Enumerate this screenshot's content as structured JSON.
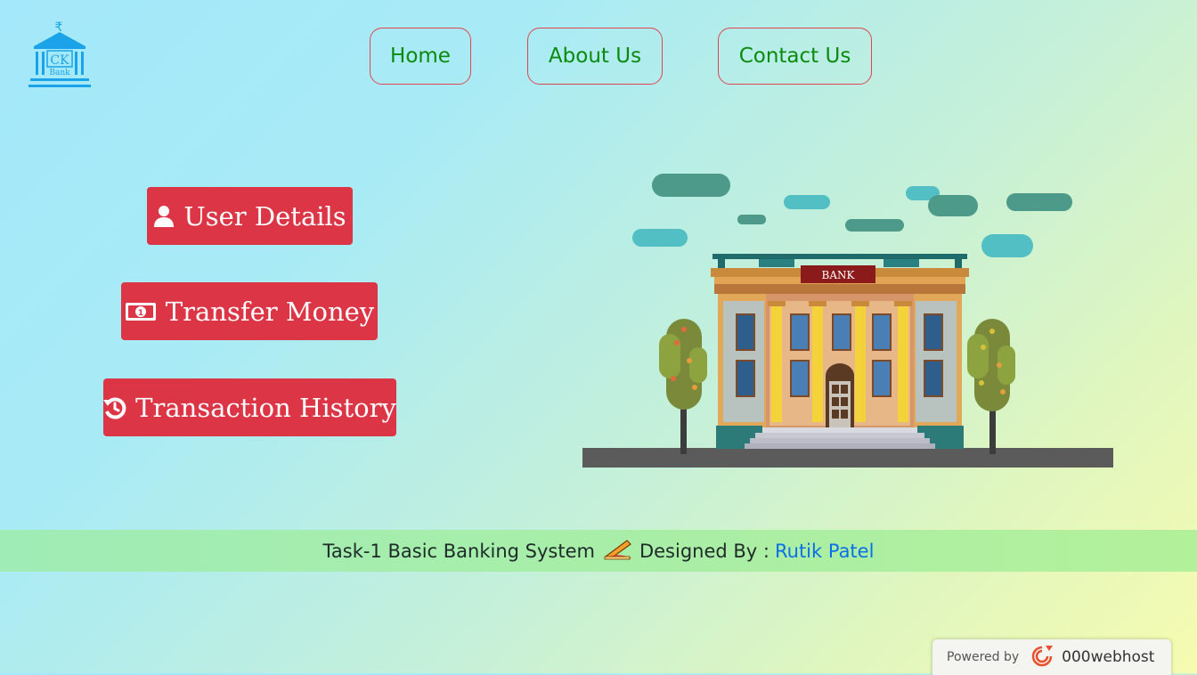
{
  "logo": {
    "text_top": "CK",
    "text_bottom": "Bank",
    "symbol": "₹",
    "color": "#1aa3e8"
  },
  "nav": {
    "items": [
      {
        "label": "Home"
      },
      {
        "label": "About Us"
      },
      {
        "label": "Contact Us"
      }
    ],
    "text_color": "#0c8a0c",
    "border_color": "#e1464f"
  },
  "actions": [
    {
      "label": "User Details",
      "icon": "user-icon"
    },
    {
      "label": "Transfer Money",
      "icon": "money-bill-icon"
    },
    {
      "label": "Transaction History",
      "icon": "history-icon"
    }
  ],
  "action_color": "#dc3545",
  "illustration": {
    "sign": "BANK"
  },
  "footer": {
    "task": "Task-1 Basic Banking System",
    "designed_by": "Designed By :",
    "author": "Rutik Patel",
    "author_color": "#0a6fe8"
  },
  "powered": {
    "label": "Powered by",
    "brand": "000webhost"
  }
}
